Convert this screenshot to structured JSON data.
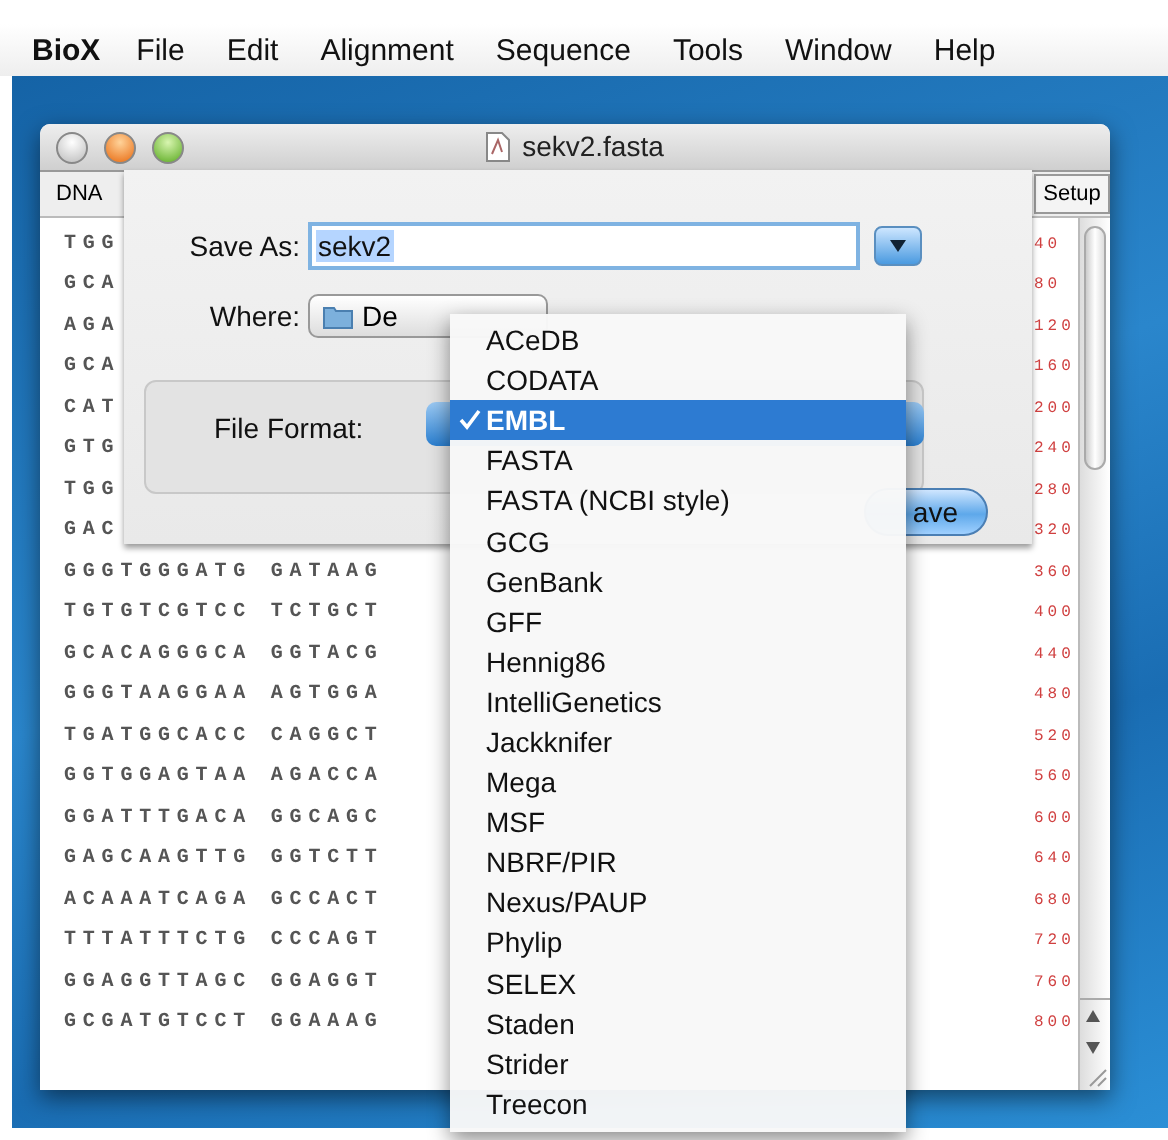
{
  "menubar": {
    "app": "BioX",
    "items": [
      "File",
      "Edit",
      "Alignment",
      "Sequence",
      "Tools",
      "Window",
      "Help"
    ]
  },
  "window": {
    "title": "sekv2.fasta",
    "toolbar": {
      "left": "DNA",
      "right": "Setup"
    },
    "sequence_rows": [
      "TGG",
      "GCA",
      "AGA",
      "GCA",
      "CAT",
      "GTG",
      "TGG",
      "GAC",
      "GGGTGGGATG GATAAG",
      "TGTGTCGTCC TCTGCT",
      "GCACAGGGCA GGTACG",
      "GGGTAAGGAA AGTGGA",
      "TGATGGCACC CAGGCT",
      "GGTGGAGTAA AGACCA",
      "GGATTTGACA GGCAGC",
      "GAGCAAGTTG GGTCTT",
      "ACAAATCAGA GCCACT",
      "TTTATTTCTG CCCAGT",
      "GGAGGTTAGC GGAGGT",
      "GCGATGTCCT GGAAAG"
    ],
    "positions": [
      "40",
      "80",
      "120",
      "160",
      "200",
      "240",
      "280",
      "320",
      "360",
      "400",
      "440",
      "480",
      "520",
      "560",
      "600",
      "640",
      "680",
      "720",
      "760",
      "800"
    ]
  },
  "save_sheet": {
    "save_as_label": "Save As:",
    "filename": {
      "value": "sekv2",
      "text_selected": true
    },
    "where_label": "Where:",
    "where_value": "De",
    "format_label": "File Format:",
    "default_button": "ave"
  },
  "format_menu": [
    {
      "label": "ACeDB",
      "selected": false
    },
    {
      "label": "CODATA",
      "selected": false
    },
    {
      "label": "EMBL",
      "selected": true
    },
    {
      "label": "FASTA",
      "selected": false
    },
    {
      "label": "FASTA (NCBI style)",
      "selected": false
    },
    {
      "label": "GCG",
      "selected": false
    },
    {
      "label": "GenBank",
      "selected": false
    },
    {
      "label": "GFF",
      "selected": false
    },
    {
      "label": "Hennig86",
      "selected": false
    },
    {
      "label": "IntelliGenetics",
      "selected": false
    },
    {
      "label": "Jackknifer",
      "selected": false
    },
    {
      "label": "Mega",
      "selected": false
    },
    {
      "label": "MSF",
      "selected": false
    },
    {
      "label": "NBRF/PIR",
      "selected": false
    },
    {
      "label": "Nexus/PAUP",
      "selected": false
    },
    {
      "label": "Phylip",
      "selected": false
    },
    {
      "label": "SELEX",
      "selected": false
    },
    {
      "label": "Staden",
      "selected": false
    },
    {
      "label": "Strider",
      "selected": false
    },
    {
      "label": "Treecon",
      "selected": false
    }
  ]
}
